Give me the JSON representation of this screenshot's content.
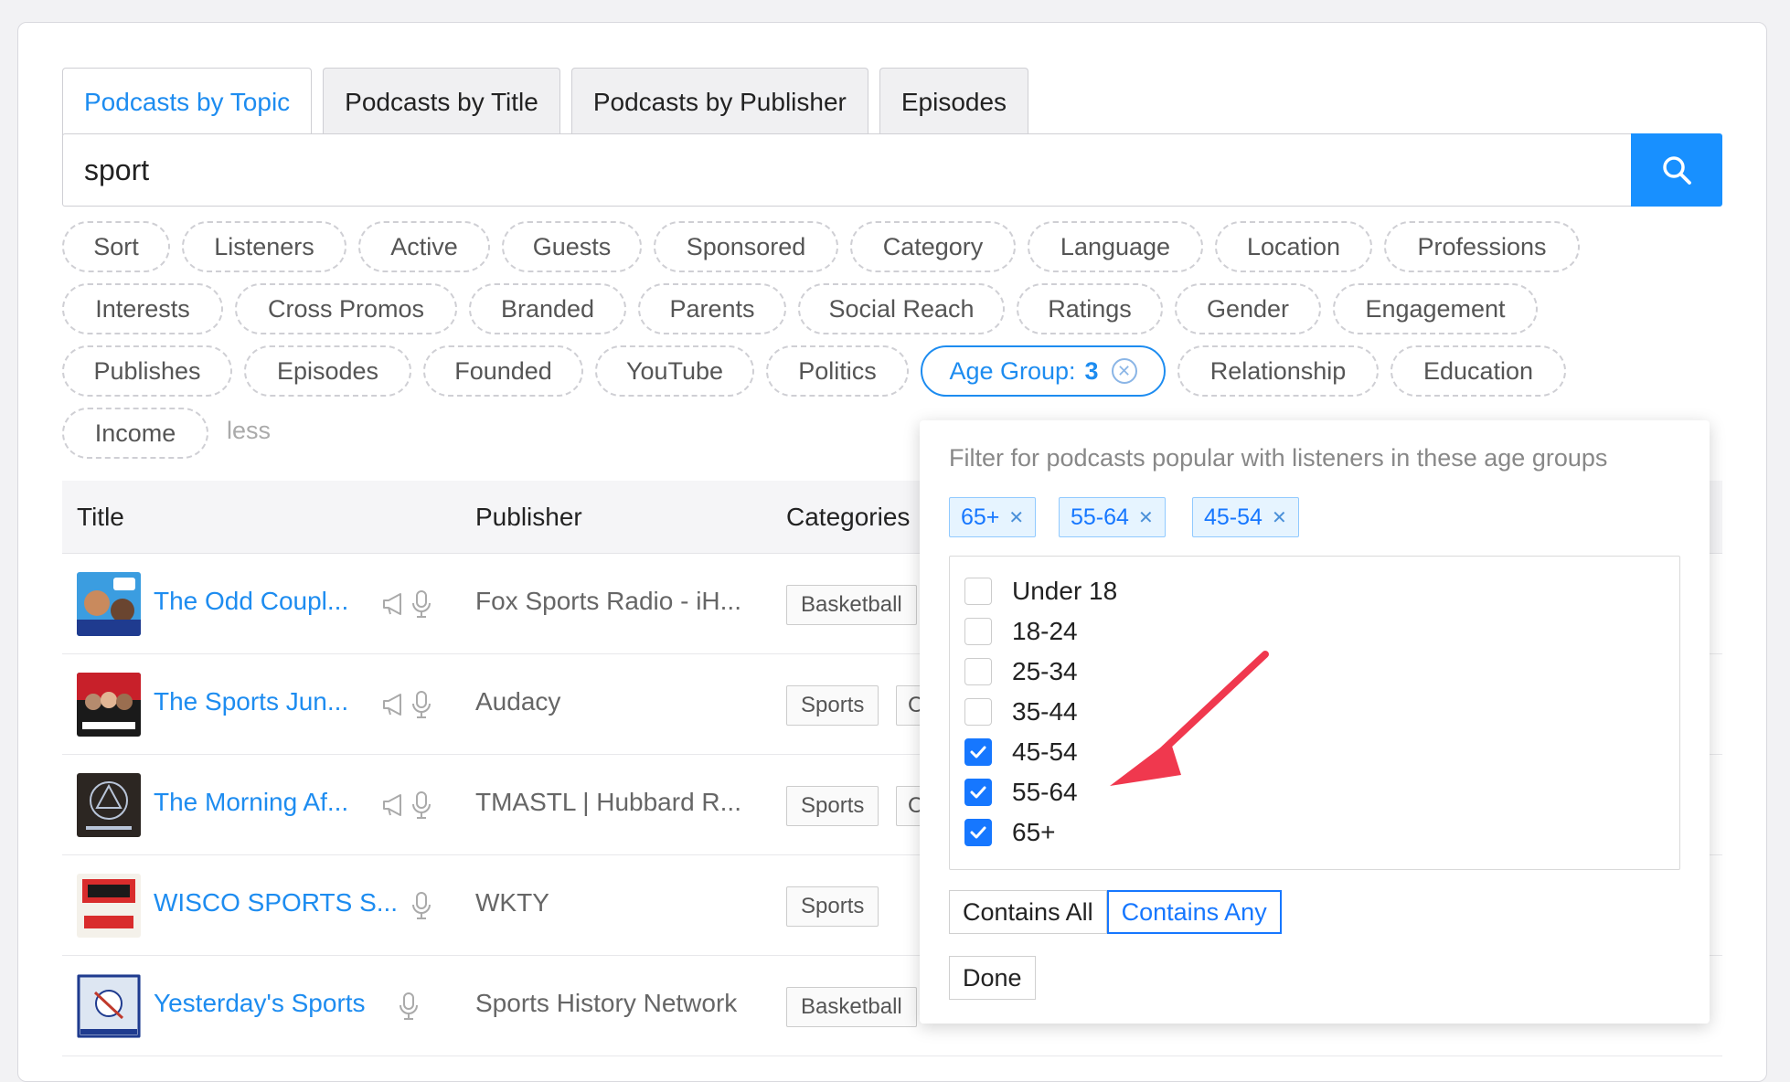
{
  "tabs": [
    {
      "label": "Podcasts by Topic",
      "active": true
    },
    {
      "label": "Podcasts by Title",
      "active": false
    },
    {
      "label": "Podcasts by Publisher",
      "active": false
    },
    {
      "label": "Episodes",
      "active": false
    }
  ],
  "search": {
    "value": "sport",
    "button_icon": "search-icon"
  },
  "filters": {
    "sort": "Sort",
    "listeners": "Listeners",
    "active": "Active",
    "guests": "Guests",
    "sponsored": "Sponsored",
    "category": "Category",
    "language": "Language",
    "location": "Location",
    "professions": "Professions",
    "interests": "Interests",
    "cross_promos": "Cross Promos",
    "branded": "Branded",
    "parents": "Parents",
    "social_reach": "Social Reach",
    "ratings": "Ratings",
    "gender": "Gender",
    "engagement": "Engagement",
    "publishes": "Publishes",
    "episodes": "Episodes",
    "founded": "Founded",
    "youtube": "YouTube",
    "politics": "Politics",
    "age_group_label": "Age Group:",
    "age_group_count": "3",
    "relationship": "Relationship",
    "education": "Education",
    "income": "Income",
    "less": "less"
  },
  "table": {
    "headers": {
      "title": "Title",
      "publisher": "Publisher",
      "categories": "Categories"
    },
    "rows": [
      {
        "title": "The Odd Coupl...",
        "publisher": "Fox Sports Radio - iH...",
        "category": "Basketball",
        "category2": "",
        "icons": [
          "megaphone-icon",
          "microphone-icon"
        ]
      },
      {
        "title": "The Sports Jun...",
        "publisher": "Audacy",
        "category": "Sports",
        "category2": "C",
        "icons": [
          "megaphone-icon",
          "microphone-icon"
        ]
      },
      {
        "title": "The Morning Af...",
        "publisher": "TMASTL | Hubbard R...",
        "category": "Sports",
        "category2": "C",
        "icons": [
          "megaphone-icon",
          "microphone-icon"
        ]
      },
      {
        "title": "WISCO SPORTS S...",
        "publisher": "WKTY",
        "category": "Sports",
        "category2": "",
        "icons": [
          "microphone-icon"
        ]
      },
      {
        "title": "Yesterday's Sports",
        "publisher": "Sports History Network",
        "category": "Basketball",
        "category2": "",
        "icons": [
          "microphone-icon"
        ]
      }
    ]
  },
  "age_popover": {
    "description": "Filter for podcasts popular with listeners in these age groups",
    "selected_tags": [
      "65+",
      "55-64",
      "45-54"
    ],
    "options": [
      {
        "label": "Under 18",
        "checked": false
      },
      {
        "label": "18-24",
        "checked": false
      },
      {
        "label": "25-34",
        "checked": false
      },
      {
        "label": "35-44",
        "checked": false
      },
      {
        "label": "45-54",
        "checked": true
      },
      {
        "label": "55-64",
        "checked": true
      },
      {
        "label": "65+",
        "checked": true
      }
    ],
    "match_modes": {
      "all": "Contains All",
      "any": "Contains Any",
      "selected": "any"
    },
    "done_label": "Done"
  },
  "colors": {
    "accent": "#1890ff",
    "annotation_arrow": "#f0384e"
  }
}
